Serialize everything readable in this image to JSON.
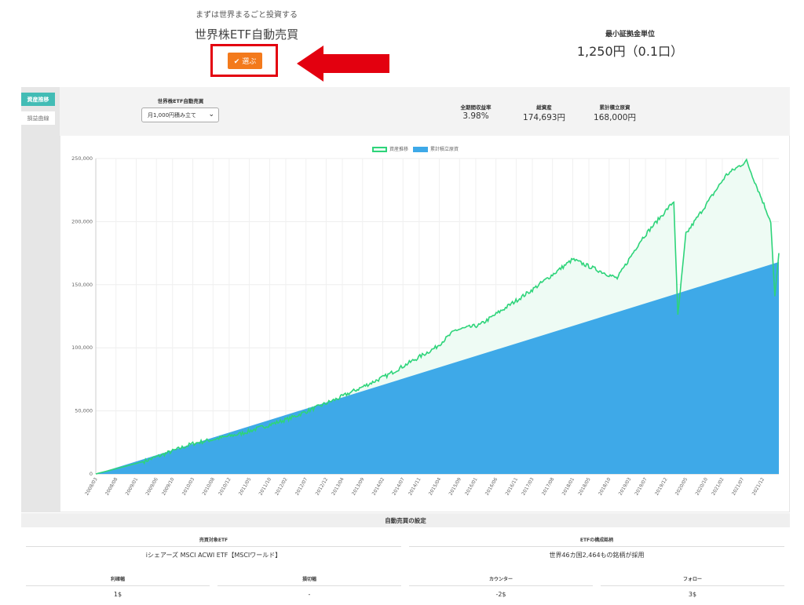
{
  "header": {
    "subtitle": "まずは世界まるごと投資する",
    "product_title": "世界株ETF自動売買",
    "select_button": "✔ 選ぶ",
    "min_unit_label": "最小証拠金単位",
    "min_unit_value": "1,250円（0.1口）"
  },
  "sidebar": {
    "tabs": [
      {
        "label": "資産推移",
        "active": true
      },
      {
        "label": "損益曲線",
        "active": false
      }
    ]
  },
  "controls": {
    "dropdown_label": "世界株ETF自動売買",
    "dropdown_value": "月1,000円積み立て"
  },
  "stats": [
    {
      "label": "全期間収益率",
      "value": "3.98%"
    },
    {
      "label": "総資産",
      "value": "174,693円"
    },
    {
      "label": "累計積立原資",
      "value": "168,000円"
    }
  ],
  "legend": [
    {
      "label": "資産推移",
      "color": "#2ed47a"
    },
    {
      "label": "累計積立原資",
      "color": "#3ea9e8"
    }
  ],
  "chart_data": {
    "type": "area",
    "series": [
      {
        "name": "資産推移",
        "color": "#2ed47a",
        "x": [
          "2008/03",
          "2009/03",
          "2010/03",
          "2011/03",
          "2012/03",
          "2013/03",
          "2014/03",
          "2015/03",
          "2015/08",
          "2016/02",
          "2017/03",
          "2018/01",
          "2018/12",
          "2019/06",
          "2020/02",
          "2020/03",
          "2020/05",
          "2021/03",
          "2021/08",
          "2022/02",
          "2022/03",
          "2022/04"
        ],
        "values": [
          0,
          10000,
          24000,
          32000,
          44000,
          60000,
          78000,
          100000,
          114000,
          118000,
          146000,
          170000,
          155000,
          186000,
          216000,
          125000,
          190000,
          237000,
          248000,
          200000,
          140000,
          175000
        ]
      },
      {
        "name": "累計積立原資",
        "color": "#3ea9e8",
        "x": [
          "2008/03",
          "2022/04"
        ],
        "values": [
          0,
          168000
        ]
      }
    ],
    "ylim": [
      0,
      250000
    ],
    "yticks": [
      "0",
      "50,000",
      "100,000",
      "150,000",
      "200,000",
      "250,000"
    ],
    "xticks": [
      "2008/03",
      "2008/08",
      "2009/01",
      "2009/06",
      "2009/10",
      "2010/03",
      "2010/08",
      "2010/12",
      "2011/05",
      "2011/10",
      "2012/02",
      "2012/07",
      "2012/12",
      "2013/04",
      "2013/09",
      "2014/02",
      "2014/07",
      "2014/11",
      "2015/04",
      "2015/09",
      "2016/01",
      "2016/06",
      "2016/11",
      "2017/03",
      "2017/08",
      "2018/01",
      "2018/05",
      "2018/10",
      "2019/03",
      "2019/07",
      "2019/12",
      "2020/05",
      "2020/10",
      "2021/02",
      "2021/07",
      "2021/12"
    ],
    "grid": true,
    "legend_position": "top-center"
  },
  "settings": {
    "title": "自動売買の設定",
    "target_label": "売買対象ETF",
    "target_value": "iシェアーズ MSCI ACWI ETF【MSCIワールド】",
    "composition_label": "ETFの構成銘柄",
    "composition_value": "世界46カ国2,464もの銘柄が採用",
    "params": [
      {
        "label": "利確幅",
        "value": "1$"
      },
      {
        "label": "損切幅",
        "value": "-"
      },
      {
        "label": "カウンター",
        "value": "-2$"
      },
      {
        "label": "フォロー",
        "value": "3$"
      }
    ]
  }
}
